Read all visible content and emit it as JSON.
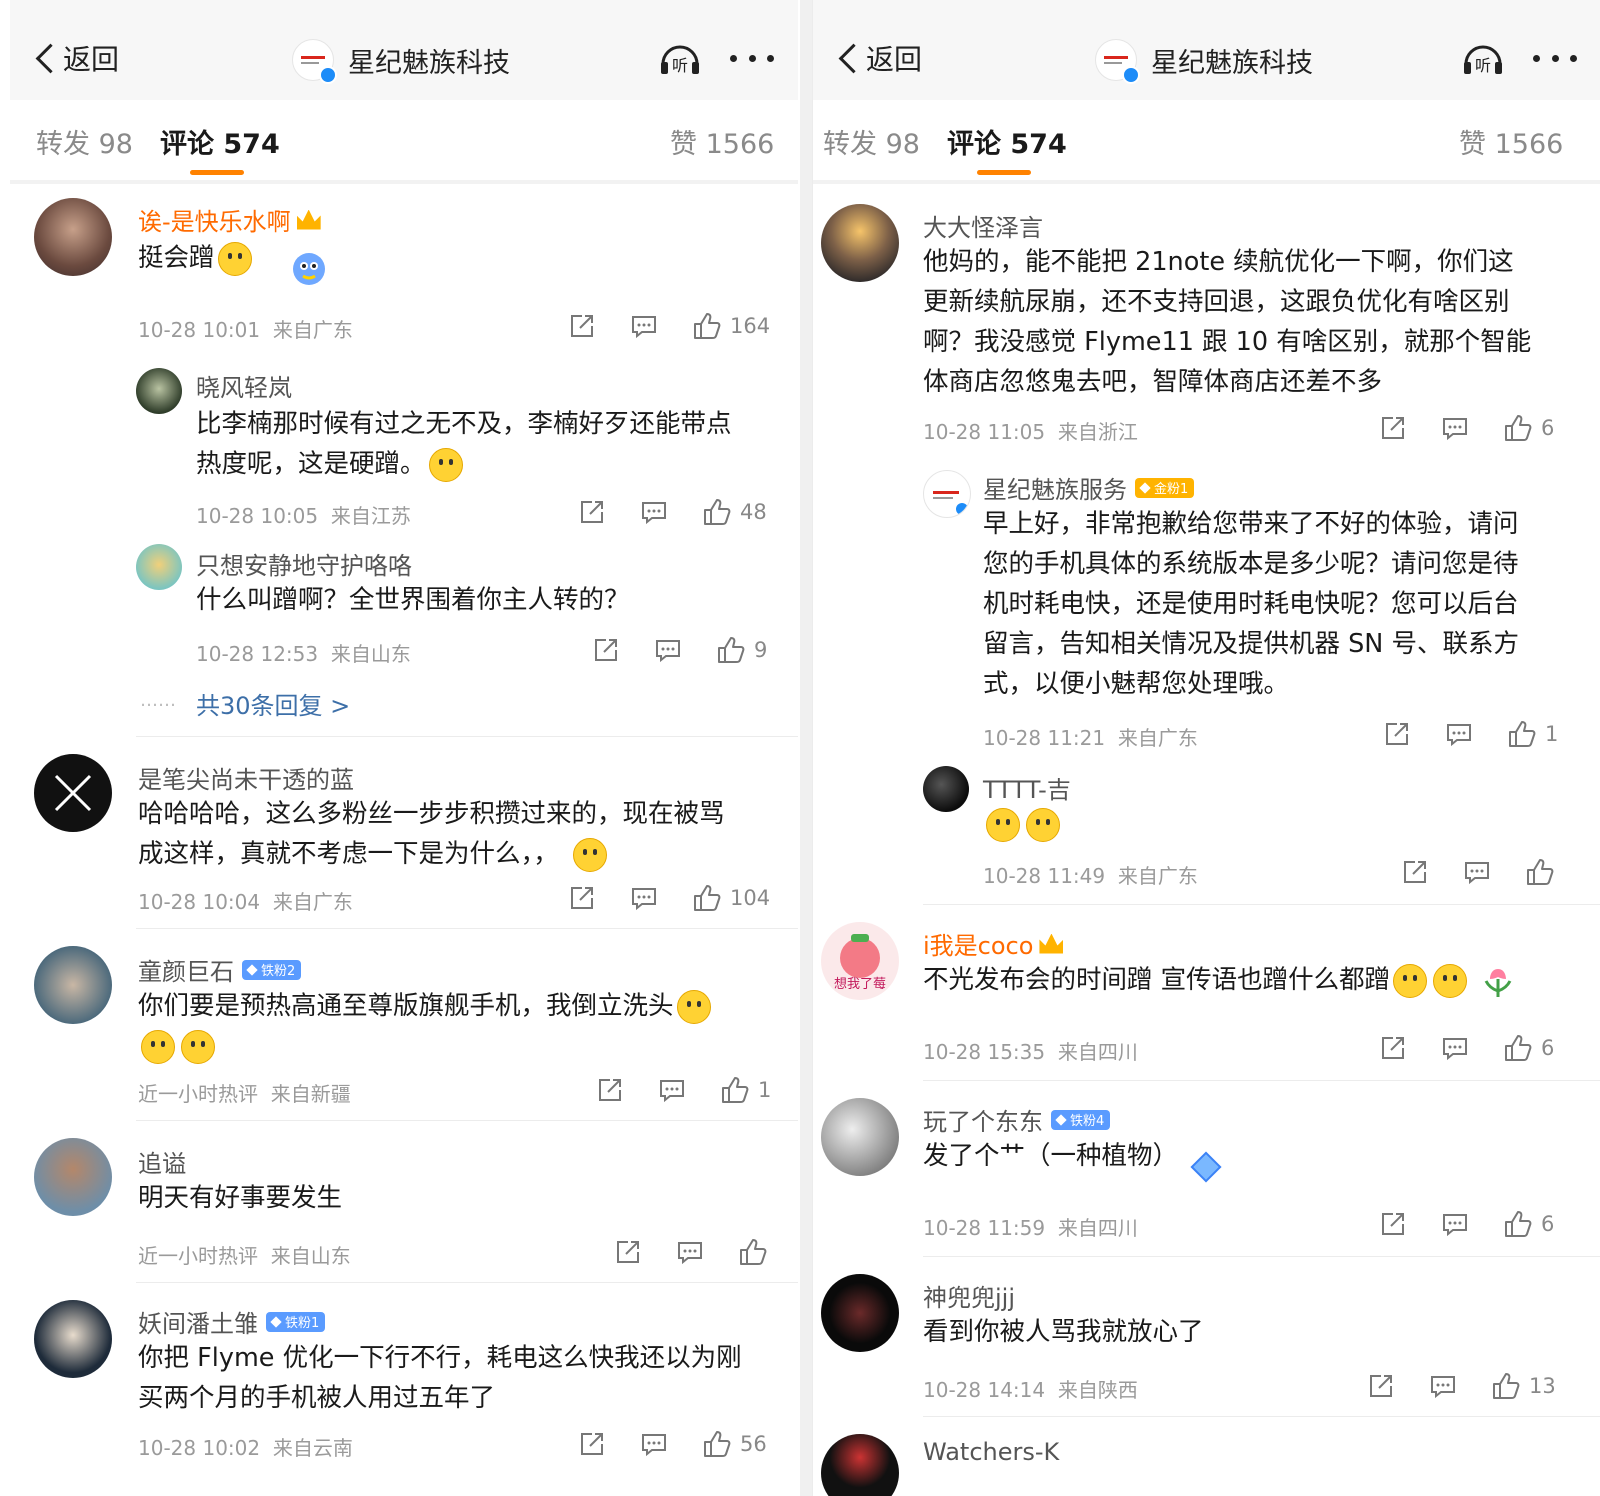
{
  "colors": {
    "accent": "#ff8200",
    "link": "#3d6fa8",
    "vip_name": "#ff6a00",
    "verified": "#1d8cf8"
  },
  "left": {
    "navbar": {
      "back_label": "返回",
      "title": "星纪魅族科技",
      "listen_icon_label": "听"
    },
    "tabs": {
      "repost": "转发 98",
      "comment": "评论 574",
      "like": "赞 1566"
    },
    "comments": [
      {
        "user": "诶-是快乐水啊",
        "text": "挺会蹭",
        "time": "10-28 10:01",
        "location": "来自广东",
        "likes": "164"
      },
      {
        "user": "是笔尖尚未干透的蓝",
        "text1": "哈哈哈哈，这么多粉丝一步步积攒过来的，现在被骂",
        "text2": "成这样，真就不考虑一下是为什么，，",
        "time": "10-28 10:04",
        "location": "来自广东",
        "likes": "104"
      },
      {
        "user": "童颜巨石",
        "badge": "铁粉2",
        "text": "你们要是预热高通至尊版旗舰手机，我倒立洗头",
        "time": "近一小时热评",
        "location": "来自新疆",
        "likes": "1"
      },
      {
        "user": "追谥",
        "text": "明天有好事要发生",
        "time": "近一小时热评",
        "location": "来自山东",
        "likes": ""
      },
      {
        "user": "妖间潘土雏",
        "badge": "铁粉1",
        "text1": "你把 Flyme 优化一下行不行，耗电这么快我还以为刚",
        "text2": "买两个月的手机被人用过五年了",
        "time": "10-28 10:02",
        "location": "来自云南",
        "likes": "56"
      }
    ],
    "replies": [
      {
        "user": "晓风轻岚",
        "text1": "比李楠那时候有过之无不及，李楠好歹还能带点",
        "text2": "热度呢，这是硬蹭。",
        "time": "10-28 10:05",
        "location": "来自江苏",
        "likes": "48"
      },
      {
        "user": "只想安静地守护咯咯",
        "text": "什么叫蹭啊？全世界围着你主人转的？",
        "time": "10-28 12:53",
        "location": "来自山东",
        "likes": "9"
      }
    ],
    "more_replies": "共30条回复 >",
    "more_dots": "……"
  },
  "right": {
    "navbar": {
      "back_label": "返回",
      "title": "星纪魅族科技",
      "listen_icon_label": "听"
    },
    "tabs": {
      "repost": "转发 98",
      "comment": "评论 574",
      "like": "赞 1566"
    },
    "comments": [
      {
        "user": "大大怪泽言",
        "lines": [
          "他妈的，能不能把 21note 续航优化一下啊，你们这",
          "更新续航尿崩，还不支持回退，这跟负优化有啥区别",
          "啊？我没感觉 Flyme11 跟 10 有啥区别，就那个智能",
          "体商店忽悠鬼去吧，智障体商店还差不多"
        ],
        "time": "10-28 11:05",
        "location": "来自浙江",
        "likes": "6"
      },
      {
        "user": "i我是coco",
        "avatar_text": "想我了莓",
        "text": "不光发布会的时间蹭  宣传语也蹭什么都蹭",
        "time": "10-28 15:35",
        "location": "来自四川",
        "likes": "6"
      },
      {
        "user": "玩了个东东",
        "badge": "铁粉4",
        "text": "发了个艹（一种植物）",
        "time": "10-28 11:59",
        "location": "来自四川",
        "likes": "6"
      },
      {
        "user": "神兜兜jjj",
        "text": "看到你被人骂我就放心了",
        "time": "10-28 14:14",
        "location": "来自陕西",
        "likes": "13"
      },
      {
        "user": "Watchers-K"
      }
    ],
    "replies": [
      {
        "user": "星纪魅族服务",
        "badge": "金粉1",
        "lines": [
          "早上好，非常抱歉给您带来了不好的体验，请问",
          "您的手机具体的系统版本是多少呢？请问您是待",
          "机时耗电快，还是使用时耗电快呢？您可以后台",
          "留言，告知相关情况及提供机器 SN 号、联系方",
          "式，以便小魅帮您处理哦。"
        ],
        "time": "10-28 11:21",
        "location": "来自广东",
        "likes": "1"
      },
      {
        "user": "TTTT-吉",
        "time": "10-28 11:49",
        "location": "来自广东",
        "likes": ""
      }
    ]
  }
}
